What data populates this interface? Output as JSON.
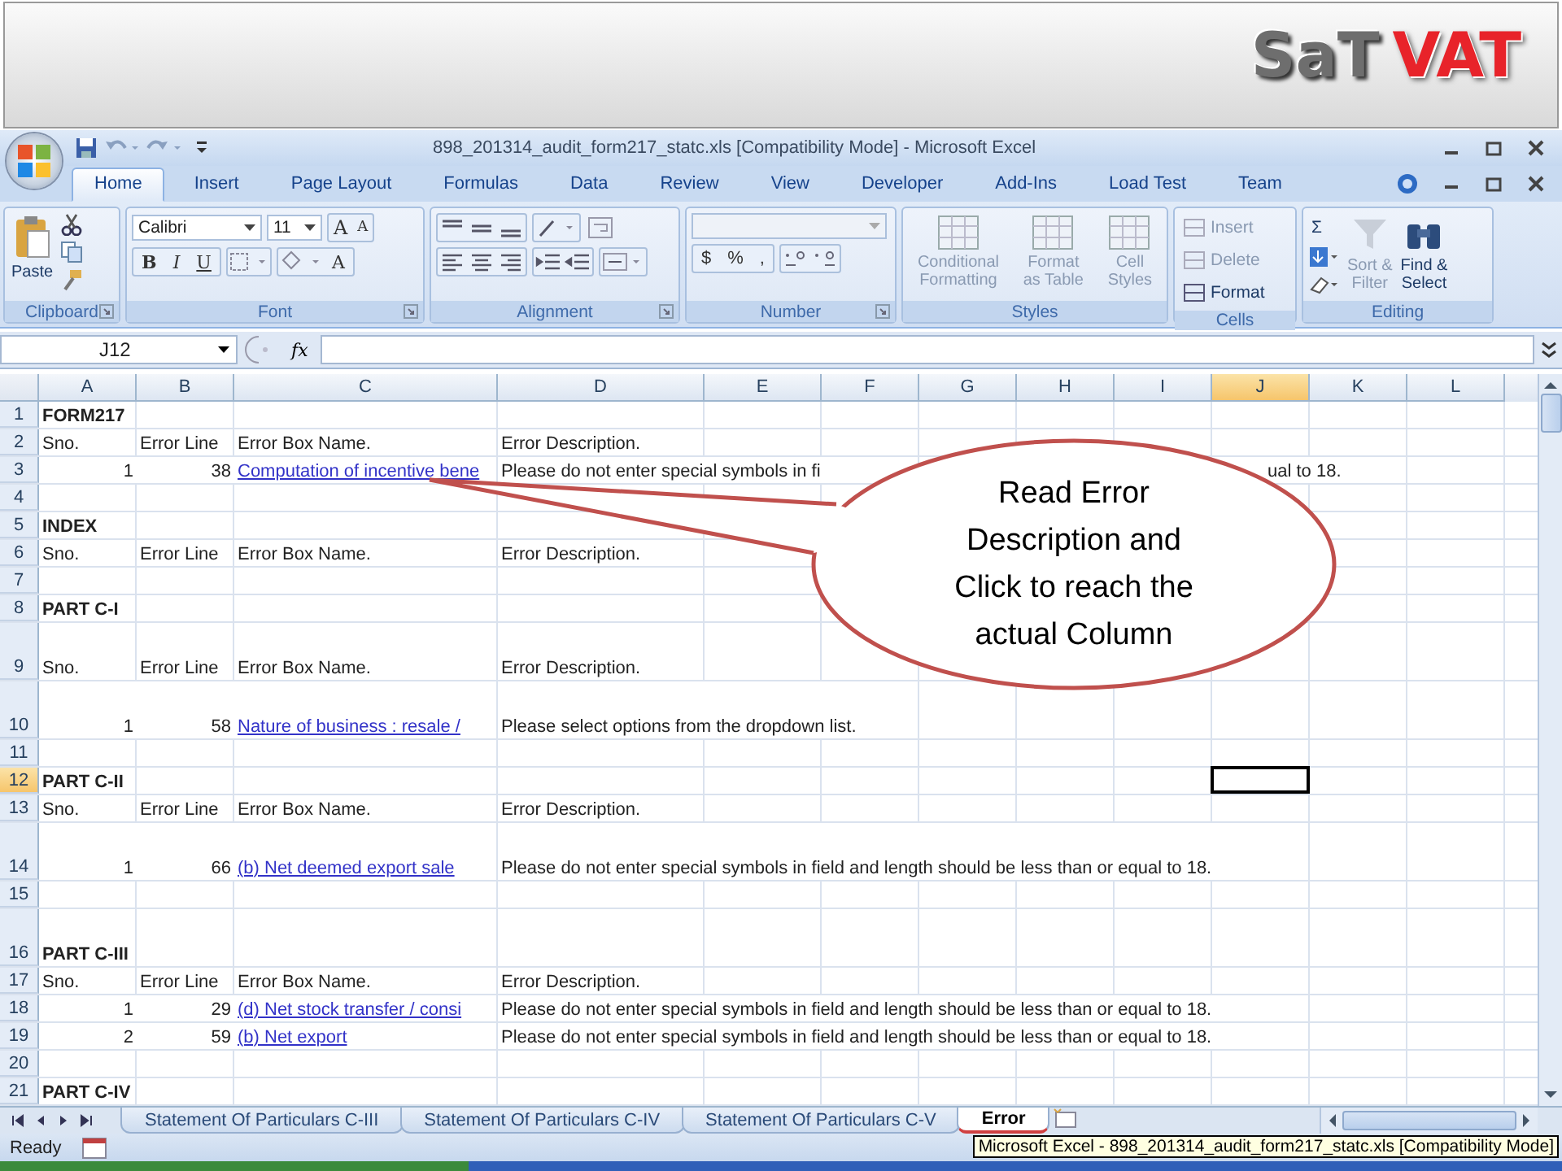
{
  "banner": {
    "logo": [
      "SaT",
      "VAT"
    ]
  },
  "window": {
    "title": "898_201314_audit_form217_statc.xls  [Compatibility Mode] - Microsoft Excel"
  },
  "tabs": [
    {
      "label": "Home",
      "selected": true
    },
    {
      "label": "Insert",
      "selected": false
    },
    {
      "label": "Page Layout",
      "selected": false
    },
    {
      "label": "Formulas",
      "selected": false
    },
    {
      "label": "Data",
      "selected": false
    },
    {
      "label": "Review",
      "selected": false
    },
    {
      "label": "View",
      "selected": false
    },
    {
      "label": "Developer",
      "selected": false
    },
    {
      "label": "Add-Ins",
      "selected": false
    },
    {
      "label": "Load Test",
      "selected": false
    },
    {
      "label": "Team",
      "selected": false
    }
  ],
  "ribbon": {
    "groups": [
      {
        "kind": "clipboard",
        "label": "Clipboard",
        "launcher": true,
        "paste": "Paste"
      },
      {
        "kind": "font",
        "label": "Font",
        "launcher": true,
        "font_name": "Calibri",
        "font_size": "11",
        "size_buttons": [
          "A",
          "A"
        ],
        "style_buttons": [
          "B",
          "I",
          "U"
        ],
        "color_button": "A"
      },
      {
        "kind": "alignment",
        "label": "Alignment",
        "launcher": true
      },
      {
        "kind": "number",
        "label": "Number",
        "launcher": true,
        "symbols": [
          "$",
          "%",
          ","
        ]
      },
      {
        "kind": "styles",
        "label": "Styles",
        "launcher": false,
        "buttons": [
          {
            "lines": [
              "Conditional",
              "Formatting"
            ],
            "disabled": true
          },
          {
            "lines": [
              "Format",
              "as Table"
            ],
            "disabled": true
          },
          {
            "lines": [
              "Cell",
              "Styles"
            ],
            "disabled": true
          }
        ]
      },
      {
        "kind": "cells",
        "label": "Cells",
        "launcher": false,
        "buttons": [
          {
            "label": "Insert",
            "disabled": true
          },
          {
            "label": "Delete",
            "disabled": true
          },
          {
            "label": "Format",
            "disabled": false
          }
        ]
      },
      {
        "kind": "editing",
        "label": "Editing",
        "launcher": false,
        "autosum": "Σ",
        "buttons": [
          {
            "lines": [
              "Sort &",
              "Filter"
            ],
            "disabled": true
          },
          {
            "lines": [
              "Find &",
              "Select"
            ],
            "disabled": false
          }
        ]
      }
    ]
  },
  "formula_bar": {
    "name_box": "J12",
    "fx": "fx"
  },
  "columns": [
    {
      "label": "A",
      "selected": false
    },
    {
      "label": "B",
      "selected": false
    },
    {
      "label": "C",
      "selected": false
    },
    {
      "label": "D",
      "selected": false
    },
    {
      "label": "E",
      "selected": false
    },
    {
      "label": "F",
      "selected": false
    },
    {
      "label": "G",
      "selected": false
    },
    {
      "label": "H",
      "selected": false
    },
    {
      "label": "I",
      "selected": false
    },
    {
      "label": "J",
      "selected": true
    },
    {
      "label": "K",
      "selected": false
    },
    {
      "label": "L",
      "selected": false
    }
  ],
  "rows": [
    {
      "number": "1",
      "kind": "section",
      "tall": false,
      "selected": false,
      "title": "FORM217"
    },
    {
      "number": "2",
      "kind": "header",
      "tall": false,
      "selected": false,
      "labels": [
        "Sno.",
        "Error Line",
        "Error Box Name.",
        "Error Description."
      ]
    },
    {
      "number": "3",
      "kind": "entry",
      "tall": false,
      "selected": false,
      "sno": "1",
      "line": "38",
      "link": "Computation of incentive bene",
      "description": "Please do not enter special symbols in fi",
      "trailing": "ual to 18."
    },
    {
      "number": "4",
      "kind": "blank",
      "tall": false,
      "selected": false
    },
    {
      "number": "5",
      "kind": "section",
      "tall": false,
      "selected": false,
      "title": "INDEX"
    },
    {
      "number": "6",
      "kind": "header",
      "tall": false,
      "selected": false,
      "labels": [
        "Sno.",
        "Error Line",
        "Error Box Name.",
        "Error Description."
      ]
    },
    {
      "number": "7",
      "kind": "blank",
      "tall": false,
      "selected": false
    },
    {
      "number": "8",
      "kind": "section",
      "tall": false,
      "selected": false,
      "title": "PART C-I"
    },
    {
      "number": "9",
      "kind": "header",
      "tall": true,
      "selected": false,
      "labels": [
        "Sno.",
        "Error Line",
        "Error Box Name.",
        "Error Description."
      ]
    },
    {
      "number": "10",
      "kind": "entry",
      "tall": true,
      "selected": false,
      "sno": "1",
      "line": "58",
      "link": "Nature of business : resale /",
      "description": "Please select options from the dropdown list."
    },
    {
      "number": "11",
      "kind": "blank",
      "tall": false,
      "selected": false
    },
    {
      "number": "12",
      "kind": "section",
      "tall": false,
      "selected": true,
      "title": "PART C-II"
    },
    {
      "number": "13",
      "kind": "header",
      "tall": false,
      "selected": false,
      "labels": [
        "Sno.",
        "Error Line",
        "Error Box Name.",
        "Error Description."
      ]
    },
    {
      "number": "14",
      "kind": "entry",
      "tall": true,
      "selected": false,
      "sno": "1",
      "line": "66",
      "link": "(b) Net deemed export sale",
      "description": "Please do not enter special symbols in field and length should be less than or equal to 18."
    },
    {
      "number": "15",
      "kind": "blank",
      "tall": false,
      "selected": false
    },
    {
      "number": "16",
      "kind": "section",
      "tall": true,
      "selected": false,
      "title": "PART C-III"
    },
    {
      "number": "17",
      "kind": "header",
      "tall": false,
      "selected": false,
      "labels": [
        "Sno.",
        "Error Line",
        "Error Box Name.",
        "Error Description."
      ]
    },
    {
      "number": "18",
      "kind": "entry",
      "tall": false,
      "selected": false,
      "sno": "1",
      "line": "29",
      "link": "(d) Net stock transfer / consi",
      "description": "Please do not enter special symbols in field and length should be less than or equal to 18."
    },
    {
      "number": "19",
      "kind": "entry",
      "tall": false,
      "selected": false,
      "sno": "2",
      "line": "59",
      "link": "(b) Net export",
      "description": "Please do not enter special symbols in field and length should be less than or equal to 18."
    },
    {
      "number": "20",
      "kind": "blank",
      "tall": false,
      "selected": false
    },
    {
      "number": "21",
      "kind": "section",
      "tall": false,
      "selected": false,
      "title": "PART C-IV"
    }
  ],
  "callout": {
    "lines": [
      "Read Error",
      "Description and",
      "Click to reach the",
      "actual Column"
    ]
  },
  "sheet_tabs": [
    {
      "label": "Statement Of Particulars C-III",
      "selected": false
    },
    {
      "label": "Statement Of Particulars C-IV",
      "selected": false
    },
    {
      "label": "Statement Of Particulars C-V",
      "selected": false
    },
    {
      "label": "Error",
      "selected": true
    }
  ],
  "status_bar": {
    "text": "Ready"
  },
  "tooltip": {
    "text": "Microsoft Excel - 898_201314_audit_form217_statc.xls  [Compatibility Mode]"
  }
}
